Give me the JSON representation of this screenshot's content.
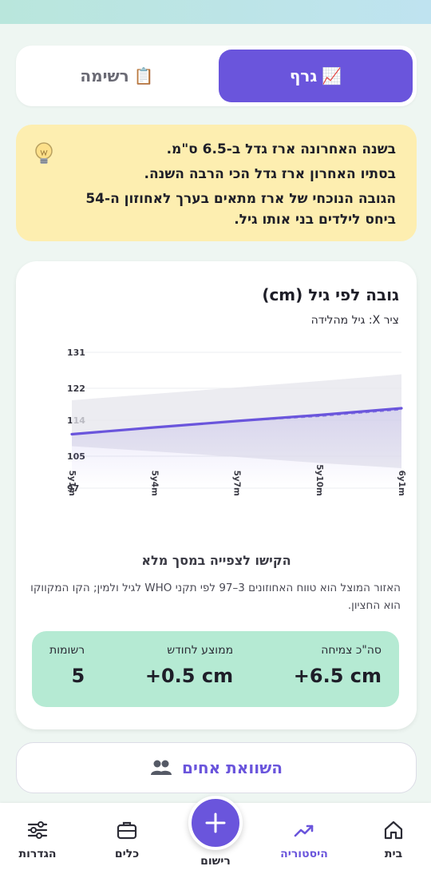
{
  "tabs": [
    {
      "label": "רשימה",
      "icon": "clipboard-icon",
      "active": false
    },
    {
      "label": "גרף",
      "icon": "chart-up-icon",
      "active": true
    }
  ],
  "insight": {
    "lines": [
      "בשנה האחרונה ארז גדל ב-6.5 ס\"מ.",
      "בסתיו האחרון ארז גדל הכי הרבה השנה.",
      "הגובה הנוכחי של ארז מתאים בערך לאחוזון ה-54 ביחס לילדים בני אותו גיל."
    ]
  },
  "chart_card": {
    "title": "גובה לפי גיל (cm)",
    "subtitle": "ציר X: גיל מהלידה",
    "hint": "הקישו לצפייה במסך מלא",
    "note": "האזור המוצל הוא טווח האחוזונים 3–97 לפי תקני WHO לגיל ולמין; הקו המקווקו הוא החציון."
  },
  "chart_data": {
    "type": "line",
    "x": [
      "5y1m",
      "5y4m",
      "5y7m",
      "5y10m",
      "6y1m"
    ],
    "xlabel": "",
    "ylabel": "",
    "yticks": [
      97,
      105,
      114,
      122,
      131
    ],
    "ylim": [
      97,
      131
    ],
    "series": [
      {
        "values": [
          110.5,
          112.2,
          113.8,
          115.3,
          117.0
        ]
      },
      {
        "values": [
          110.5,
          112.2,
          113.8,
          115.0,
          116.7
        ]
      }
    ],
    "band_upper": [
      119.0,
      120.6,
      122.2,
      123.8,
      125.5
    ],
    "band_lower": [
      107.5,
      106.2,
      104.8,
      103.3,
      102.0
    ],
    "grid": true,
    "colors": {
      "line": "#6a55dc",
      "band": "#e6e6ec"
    }
  },
  "stats": [
    {
      "label": "סה\"כ צמיחה",
      "value": "+6.5 cm"
    },
    {
      "label": "ממוצע לחודש",
      "value": "+0.5 cm"
    },
    {
      "label": "רשומות",
      "value": "5"
    }
  ],
  "compare_button": {
    "label": "השוואת אחים",
    "icon": "people-icon"
  },
  "nav": {
    "items": [
      {
        "label": "בית",
        "icon": "home-icon",
        "active": false
      },
      {
        "label": "היסטוריה",
        "icon": "trend-icon",
        "active": true
      },
      {
        "label": "רישום",
        "icon": "plus-icon",
        "active": false
      },
      {
        "label": "כלים",
        "icon": "briefcase-icon",
        "active": false
      },
      {
        "label": "הגדרות",
        "icon": "sliders-icon",
        "active": false
      }
    ]
  },
  "colors": {
    "accent": "#6a55dc",
    "insight_bg": "#fdeeb0",
    "stats_bg": "#b5ead3"
  }
}
